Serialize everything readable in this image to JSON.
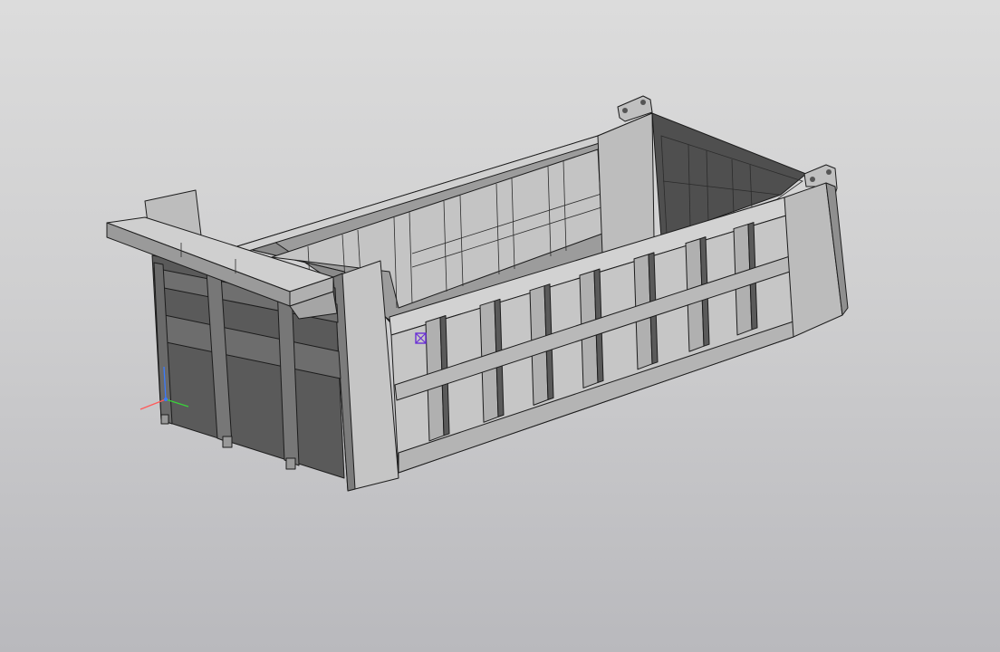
{
  "viewport": {
    "background_top": "#dcdcdc",
    "background_bottom": "#b9b9bd"
  },
  "model": {
    "object": "dump-truck-body",
    "colors": {
      "light_face": "#c9c9c9",
      "mid_face": "#a9a9a9",
      "dark_face": "#6a6a6a",
      "darkest_face": "#4e4e4e",
      "edge": "#1c1c1c",
      "selection_marker": "#6a2fd6"
    }
  },
  "triad": {
    "x_axis_color": "#ff5a5a",
    "y_axis_color": "#3ad13a",
    "z_axis_color": "#3b7bff"
  }
}
